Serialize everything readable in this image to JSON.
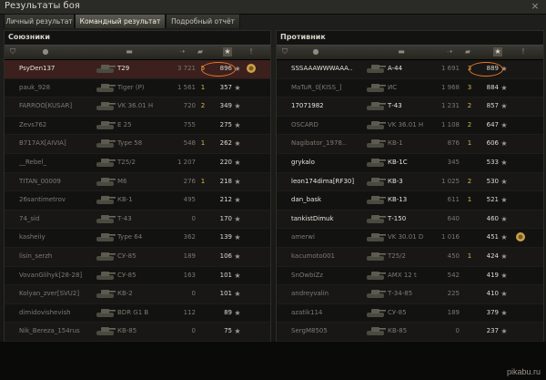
{
  "window": {
    "title": "Результаты боя",
    "close_glyph": "×"
  },
  "tabs": [
    {
      "label": "Личный результат",
      "active": false
    },
    {
      "label": "Командный результат",
      "active": true
    },
    {
      "label": "Подробный отчёт",
      "active": false
    }
  ],
  "allies": {
    "title": "Союзники",
    "rows": [
      {
        "player": "PsyDen137",
        "tank": "T29",
        "damage": "3 721",
        "kills": "5",
        "xp": "896",
        "medal": true,
        "highlight": true,
        "dead": false,
        "me": true
      },
      {
        "player": "pauk_928",
        "tank": "Tiger (P)",
        "damage": "1 561",
        "kills": "1",
        "xp": "357",
        "medal": false,
        "dead": true
      },
      {
        "player": "FARROO[KUSAR]",
        "tank": "VK 36.01 H",
        "damage": "720",
        "kills": "2",
        "xp": "349",
        "medal": false,
        "dead": true
      },
      {
        "player": "Zevs762",
        "tank": "E 25",
        "damage": "755",
        "kills": "",
        "xp": "275",
        "medal": false,
        "dead": true
      },
      {
        "player": "B717AX[AIVIA]",
        "tank": "Type 58",
        "damage": "548",
        "kills": "1",
        "xp": "262",
        "medal": false,
        "dead": true
      },
      {
        "player": "__Rebel_",
        "tank": "T25/2",
        "damage": "1 207",
        "kills": "",
        "xp": "220",
        "medal": false,
        "dead": true
      },
      {
        "player": "TITAN_00009",
        "tank": "M6",
        "damage": "276",
        "kills": "1",
        "xp": "218",
        "medal": false,
        "dead": true
      },
      {
        "player": "26santimetrov",
        "tank": "КВ-1",
        "damage": "495",
        "kills": "",
        "xp": "212",
        "medal": false,
        "dead": true
      },
      {
        "player": "74_sid",
        "tank": "Т-43",
        "damage": "0",
        "kills": "",
        "xp": "170",
        "medal": false,
        "dead": true
      },
      {
        "player": "kasheiiy",
        "tank": "Type 64",
        "damage": "362",
        "kills": "",
        "xp": "139",
        "medal": false,
        "dead": true
      },
      {
        "player": "lisin_serzh",
        "tank": "СУ-85",
        "damage": "189",
        "kills": "",
        "xp": "106",
        "medal": false,
        "dead": true
      },
      {
        "player": "VovanGlihyk[28-28]",
        "tank": "СУ-85",
        "damage": "163",
        "kills": "",
        "xp": "101",
        "medal": false,
        "dead": true
      },
      {
        "player": "Kolyan_zver[SVU2]",
        "tank": "КВ-2",
        "damage": "0",
        "kills": "",
        "xp": "101",
        "medal": false,
        "dead": true
      },
      {
        "player": "dimidovishevish",
        "tank": "BDR G1 B",
        "damage": "112",
        "kills": "",
        "xp": "89",
        "medal": false,
        "dead": true
      },
      {
        "player": "Nik_Bereza_154rus",
        "tank": "КВ-85",
        "damage": "0",
        "kills": "",
        "xp": "75",
        "medal": false,
        "dead": true
      }
    ]
  },
  "enemies": {
    "title": "Противник",
    "rows": [
      {
        "player": "SSSAAAWWWAAA..",
        "tank": "A-44",
        "damage": "1 691",
        "kills": "3",
        "xp": "889",
        "medal": false,
        "highlight": true,
        "dead": false
      },
      {
        "player": "MaTuR_0[KISS_]",
        "tank": "ИС",
        "damage": "1 968",
        "kills": "3",
        "xp": "884",
        "medal": false,
        "dead": true
      },
      {
        "player": "17071982",
        "tank": "Т-43",
        "damage": "1 231",
        "kills": "2",
        "xp": "857",
        "medal": false,
        "dead": false
      },
      {
        "player": "OSCARD",
        "tank": "VK 36.01 H",
        "damage": "1 108",
        "kills": "2",
        "xp": "647",
        "medal": false,
        "dead": true
      },
      {
        "player": "Nagibator_1978..",
        "tank": "КВ-1",
        "damage": "876",
        "kills": "1",
        "xp": "606",
        "medal": false,
        "dead": true
      },
      {
        "player": "grykalo",
        "tank": "КВ-1С",
        "damage": "345",
        "kills": "",
        "xp": "533",
        "medal": false,
        "dead": false
      },
      {
        "player": "leon174dima[RF30]",
        "tank": "КВ-3",
        "damage": "1 025",
        "kills": "2",
        "xp": "530",
        "medal": false,
        "dead": false
      },
      {
        "player": "dan_bask",
        "tank": "КВ-13",
        "damage": "611",
        "kills": "1",
        "xp": "521",
        "medal": false,
        "dead": false
      },
      {
        "player": "tankistDimuk",
        "tank": "Т-150",
        "damage": "640",
        "kills": "",
        "xp": "460",
        "medal": false,
        "dead": false
      },
      {
        "player": "amerwi",
        "tank": "VK 30.01 D",
        "damage": "1 016",
        "kills": "",
        "xp": "451",
        "medal": true,
        "dead": true
      },
      {
        "player": "kacumoto001",
        "tank": "T25/2",
        "damage": "450",
        "kills": "1",
        "xp": "424",
        "medal": false,
        "dead": true
      },
      {
        "player": "SnOwbiZz",
        "tank": "AMX 12 t",
        "damage": "542",
        "kills": "",
        "xp": "419",
        "medal": false,
        "dead": true
      },
      {
        "player": "andreyvalin",
        "tank": "Т-34-85",
        "damage": "225",
        "kills": "",
        "xp": "410",
        "medal": false,
        "dead": true
      },
      {
        "player": "azatik114",
        "tank": "СУ-85",
        "damage": "189",
        "kills": "",
        "xp": "379",
        "medal": false,
        "dead": true
      },
      {
        "player": "SergM8505",
        "tank": "КВ-85",
        "damage": "0",
        "kills": "",
        "xp": "237",
        "medal": false,
        "dead": true
      }
    ]
  },
  "icons": {
    "star": "★",
    "medal": "medal-icon",
    "squad": "shield-icon",
    "player": "person-icon",
    "tank": "tank-icon",
    "damage": "shell-icon",
    "kills": "tank-kill-icon",
    "xp": "star-icon",
    "info": "info-icon"
  },
  "colors": {
    "accent": "#e8762a",
    "gold": "#d9b84a",
    "me_row": "#3b201e"
  },
  "watermark": "pikabu.ru"
}
